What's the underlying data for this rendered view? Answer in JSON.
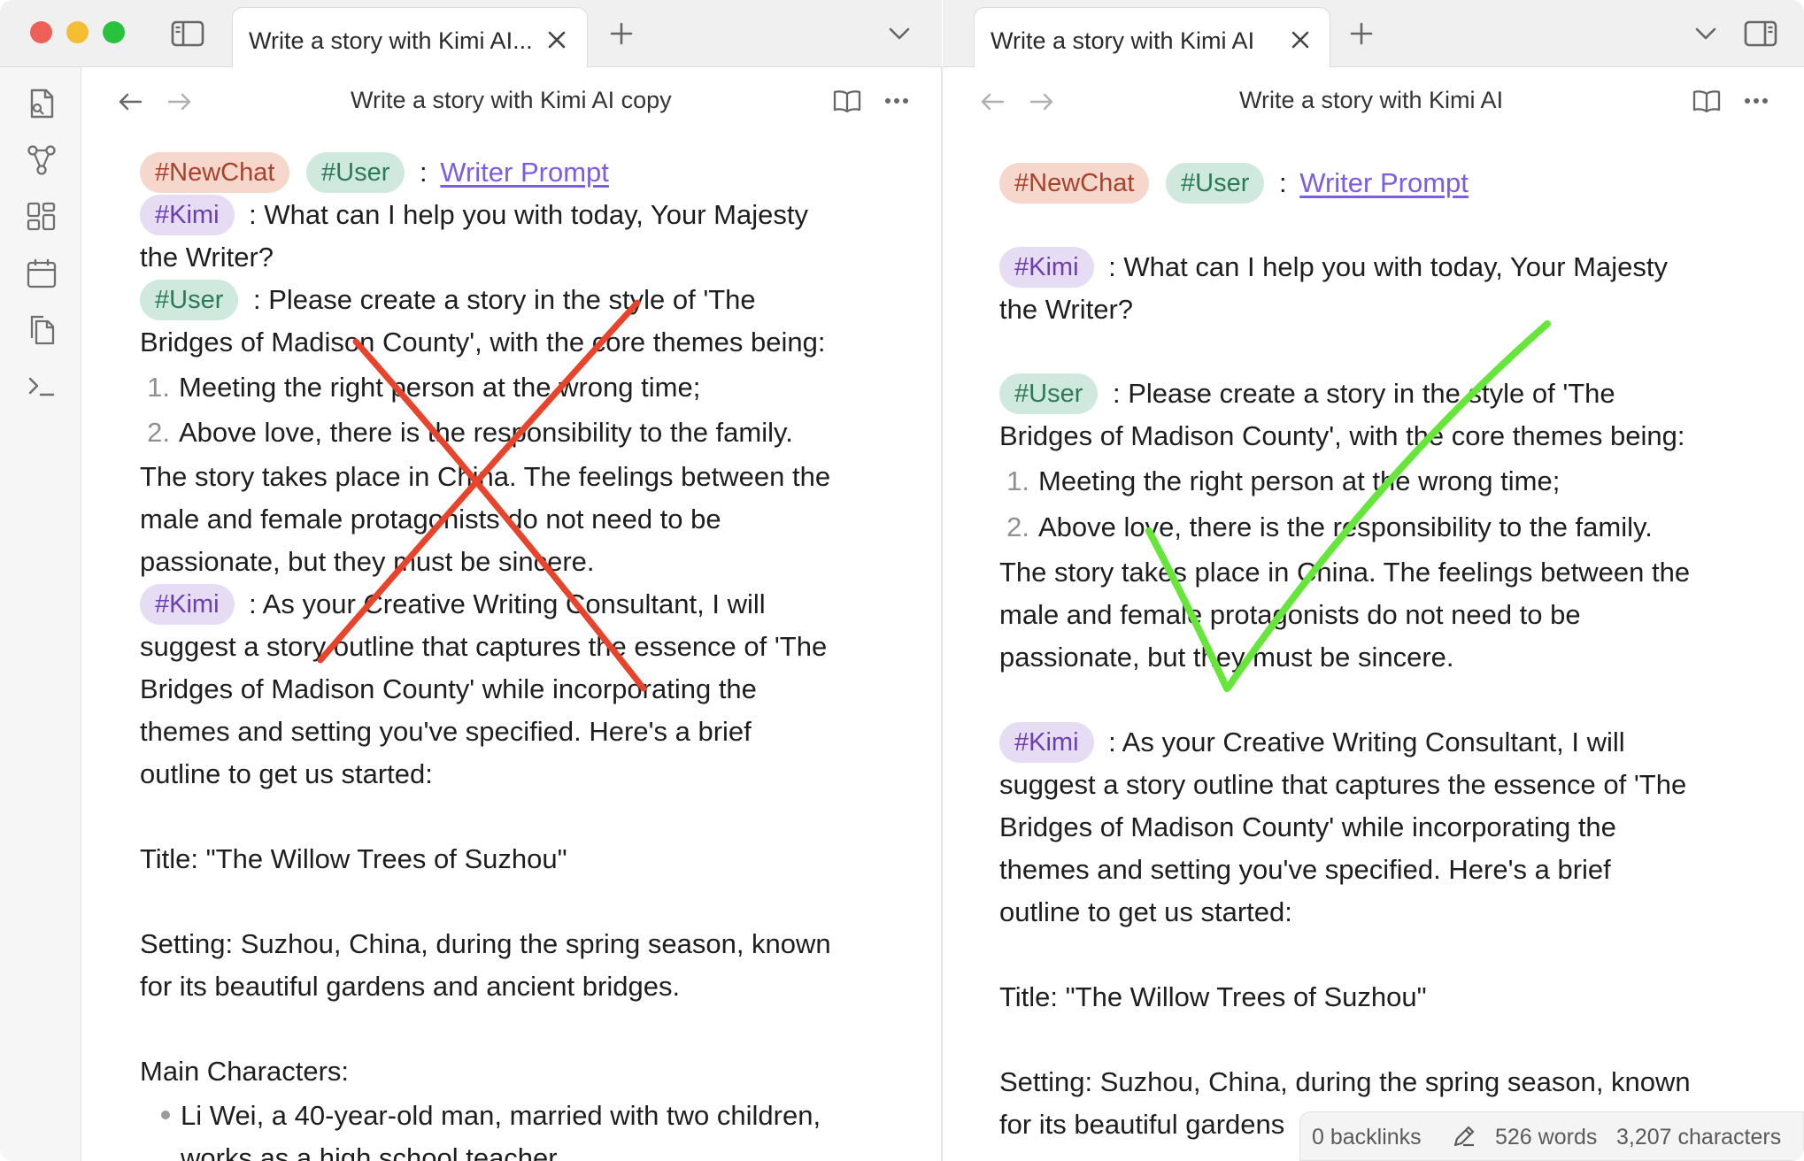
{
  "left": {
    "tab_title": "Write a story with Kimi AI...",
    "view_title": "Write a story with Kimi AI copy",
    "lines": [
      {
        "t": "Writer Prompt"
      },
      {
        "t": "What can I help you with today, Your Majesty"
      },
      {
        "t": "the Writer?"
      },
      {
        "t": "Please create a story in the style of 'The"
      },
      {
        "t": "Bridges of Madison County', with the core themes being:"
      },
      {
        "t": "Meeting the right person at the wrong time;"
      },
      {
        "t": "Above love, there is the responsibility to the family."
      },
      {
        "t": "The story takes place in China. The feelings between the"
      },
      {
        "t": "male and female protagonists do not need to be"
      },
      {
        "t": "passionate, but they must be sincere."
      },
      {
        "t": "As your Creative Writing Consultant, I will"
      },
      {
        "t": "suggest a story outline that captures the essence of 'The"
      },
      {
        "t": "Bridges of Madison County' while incorporating the"
      },
      {
        "t": "themes and setting you've specified. Here's a brief"
      },
      {
        "t": "outline to get us started:"
      },
      {
        "t": "Title: \"The Willow Trees of Suzhou\""
      },
      {
        "t": "Setting: Suzhou, China, during the spring season, known"
      },
      {
        "t": "for its beautiful gardens and ancient bridges."
      },
      {
        "t": "Main Characters:"
      },
      {
        "t": "Li Wei, a 40-year-old man, married with two children,"
      },
      {
        "t": "works as a high school teacher"
      }
    ]
  },
  "right": {
    "tab_title": "Write a story with Kimi AI",
    "view_title": "Write a story with Kimi AI",
    "lines": [
      {
        "t": "Writer Prompt"
      },
      {
        "t": "What can I help you with today, Your Majesty"
      },
      {
        "t": "the Writer?"
      },
      {
        "t": "Please create a story in the style of 'The"
      },
      {
        "t": "Bridges of Madison County', with the core themes being:"
      },
      {
        "t": "Meeting the right person at the wrong time;"
      },
      {
        "t": "Above love, there is the responsibility to the family."
      },
      {
        "t": "The story takes place in China. The feelings between the"
      },
      {
        "t": "male and female protagonists do not need to be"
      },
      {
        "t": "passionate, but they must be sincere."
      },
      {
        "t": "As your Creative Writing Consultant, I will"
      },
      {
        "t": "suggest a story outline that captures the essence of 'The"
      },
      {
        "t": "Bridges of Madison County' while incorporating the"
      },
      {
        "t": "themes and setting you've specified. Here's a brief"
      },
      {
        "t": "outline to get us started:"
      },
      {
        "t": "Title: \"The Willow Trees of Suzhou\""
      },
      {
        "t": "Setting: Suzhou, China, during the spring season, known"
      },
      {
        "t": "for its beautiful gardens"
      }
    ]
  },
  "tags": {
    "newchat": "#NewChat",
    "user": "#User",
    "kimi": "#Kimi"
  },
  "list_numbers": {
    "one": "1.",
    "two": "2."
  },
  "separator": ":",
  "status": {
    "backlinks": "0 backlinks",
    "words": "526 words",
    "characters": "3,207 characters"
  },
  "colors": {
    "x_mark": "#e8432b",
    "check_mark": "#66e53a",
    "link": "#7c5ce4"
  },
  "icons": [
    "sidebar-toggle-icon",
    "close-icon",
    "plus-icon",
    "chevron-down-icon",
    "back-arrow-icon",
    "forward-arrow-icon",
    "reading-view-icon",
    "more-options-icon",
    "open-quick-switcher-icon",
    "graph-view-icon",
    "canvas-icon",
    "daily-note-icon",
    "templates-icon",
    "command-palette-icon",
    "pencil-icon"
  ]
}
